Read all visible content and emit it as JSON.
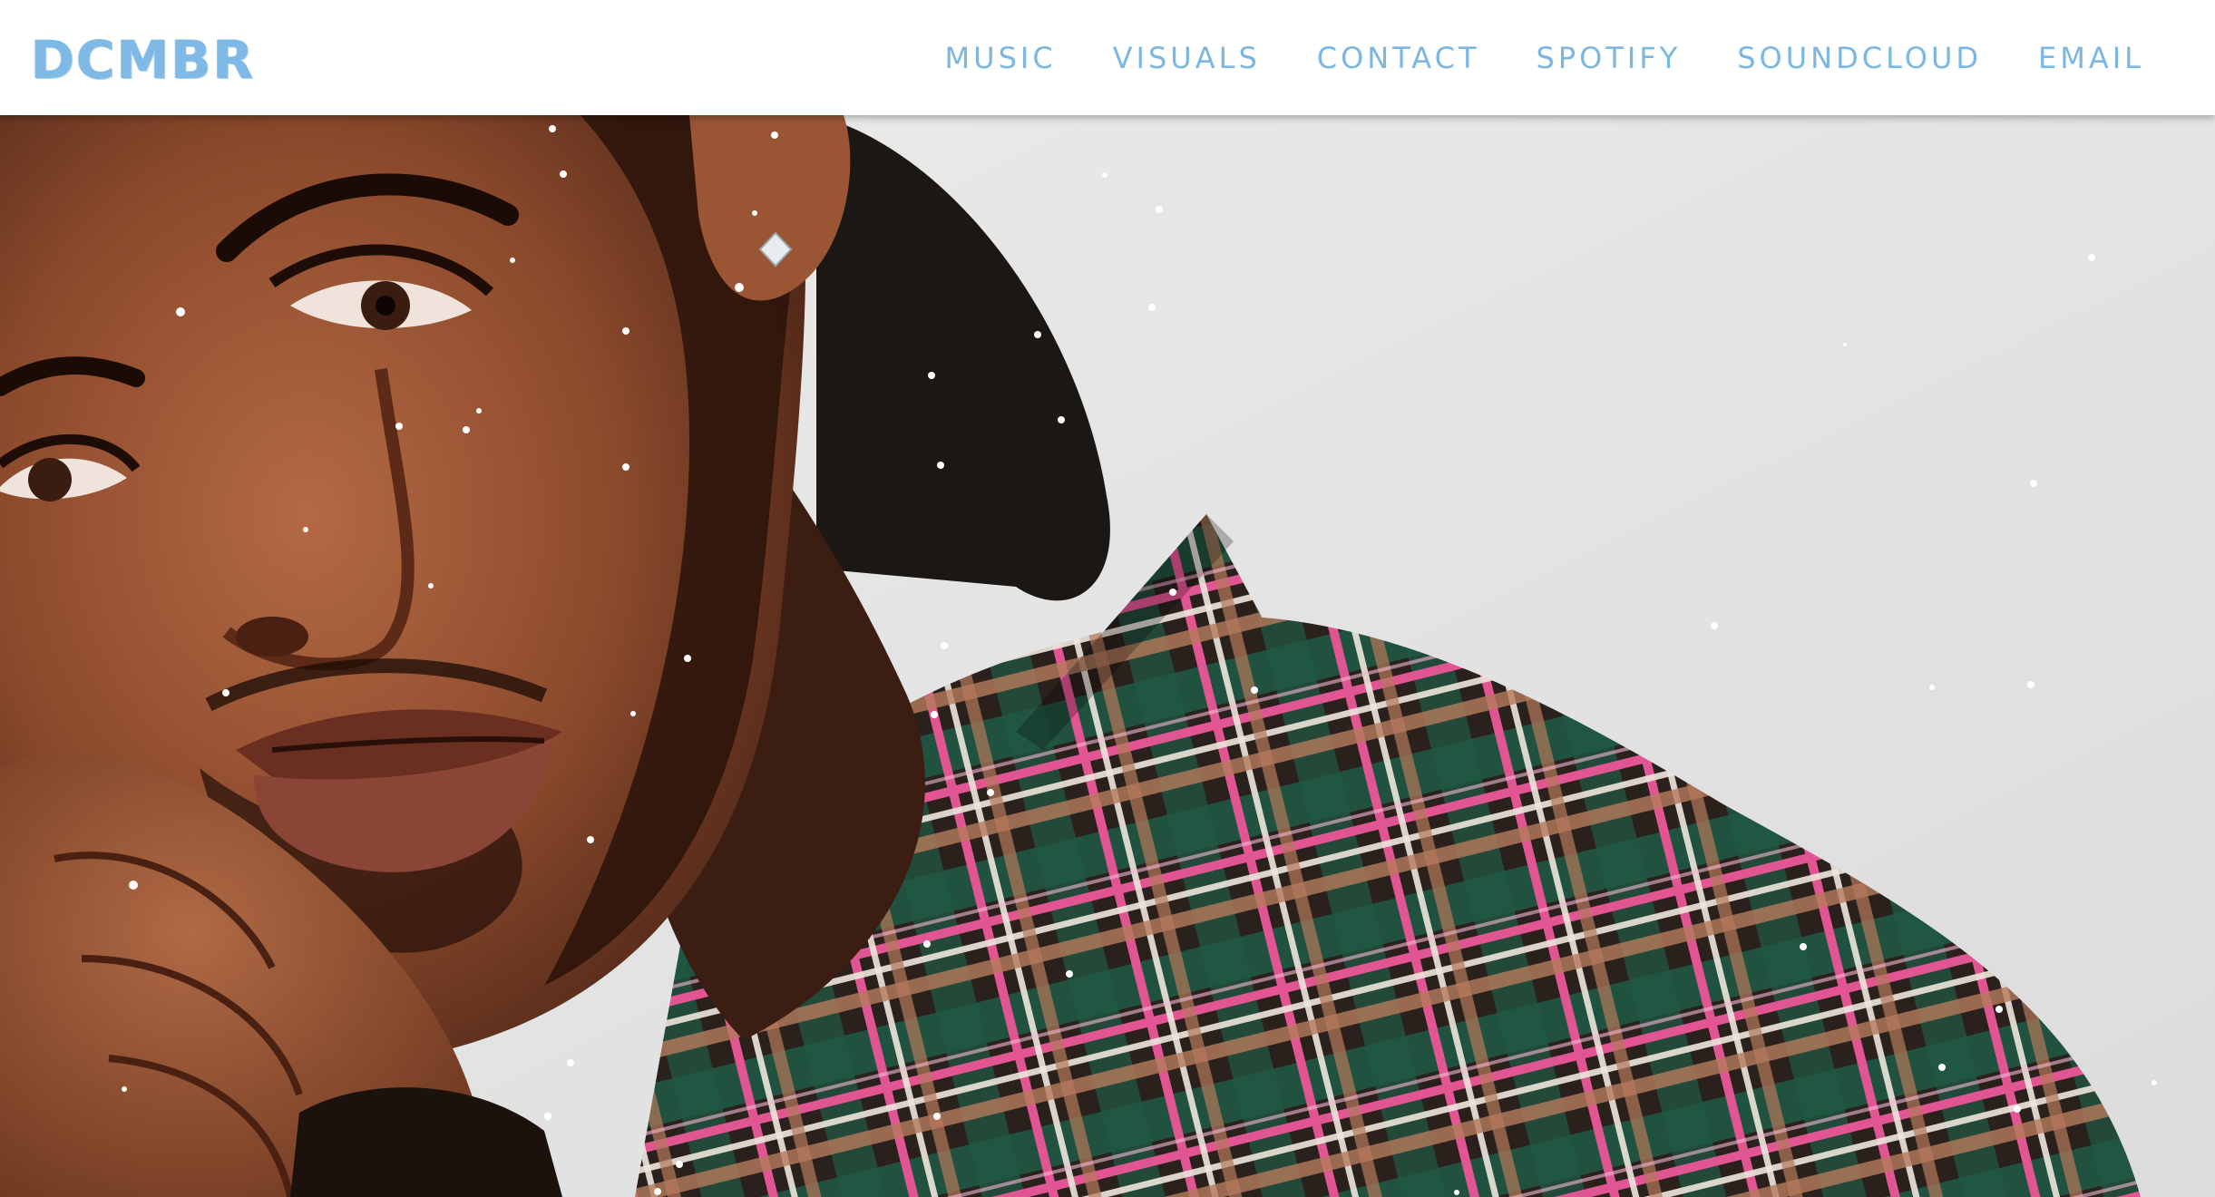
{
  "brand": {
    "logo_text": "DCMBR",
    "accent_color": "#7cb6e3"
  },
  "nav": {
    "items": [
      {
        "label": "MUSIC"
      },
      {
        "label": "VISUALS"
      },
      {
        "label": "CONTACT"
      },
      {
        "label": "SPOTIFY"
      },
      {
        "label": "SOUNDCLOUD"
      },
      {
        "label": "EMAIL"
      }
    ]
  },
  "hero": {
    "image_subject": "portrait-photo",
    "overlay": "falling-snow-particles"
  }
}
